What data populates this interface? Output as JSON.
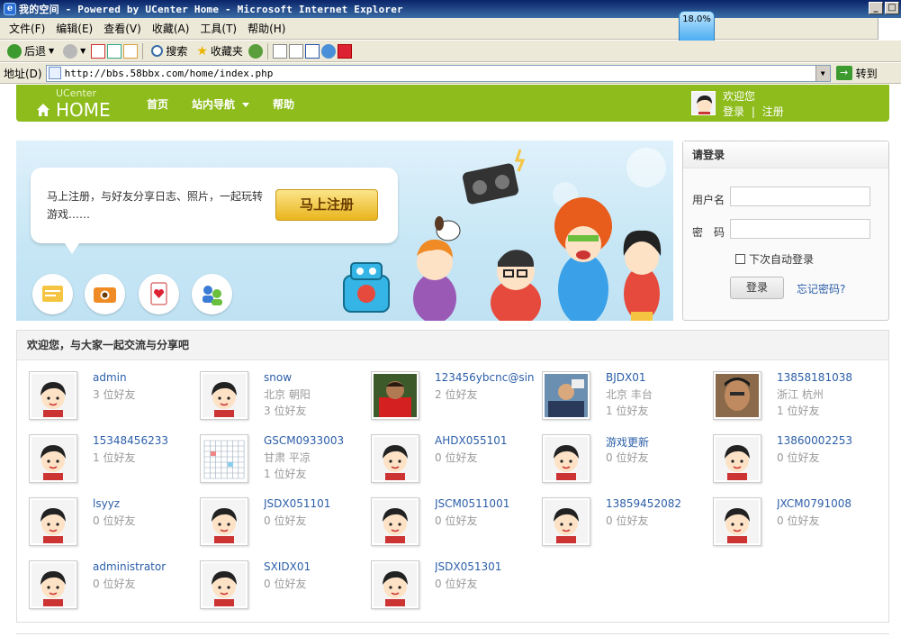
{
  "window": {
    "title": "我的空间 - Powered by UCenter Home - Microsoft Internet Explorer",
    "zoom_badge": "18.0%"
  },
  "menu": [
    "文件(F)",
    "编辑(E)",
    "查看(V)",
    "收藏(A)",
    "工具(T)",
    "帮助(H)"
  ],
  "toolbar": {
    "back": "后退",
    "search": "搜索",
    "favorites": "收藏夹"
  },
  "address": {
    "label": "地址(D)",
    "url": "http://bbs.58bbx.com/home/index.php",
    "go": "转到"
  },
  "site": {
    "logo_small": "UCenter",
    "logo_big": "HOME",
    "nav": [
      "首页",
      "站内导航",
      "帮助"
    ],
    "welcome": "欢迎您",
    "login_link": "登录",
    "register_link": "注册",
    "sep": "|"
  },
  "banner": {
    "text": "马上注册，与好友分享日志、照片，一起玩转游戏……",
    "signup_button": "马上注册"
  },
  "login": {
    "title": "请登录",
    "username_label": "用户名",
    "password_label": "密　码",
    "remember": "下次自动登录",
    "submit": "登录",
    "forgot": "忘记密码?"
  },
  "friends": {
    "heading": "欢迎您，与大家一起交流与分享吧",
    "items": [
      {
        "name": "admin",
        "line2": "3 位好友",
        "line3": "",
        "avatar": "default"
      },
      {
        "name": "snow",
        "line2": "北京 朝阳",
        "line3": "3 位好友",
        "avatar": "default"
      },
      {
        "name": "123456ybcnc@sin",
        "line2": "2 位好友",
        "line3": "",
        "avatar": "photo-red"
      },
      {
        "name": "BJDX01",
        "line2": "北京 丰台",
        "line3": "1 位好友",
        "avatar": "photo-blue"
      },
      {
        "name": "13858181038",
        "line2": "浙江 杭州",
        "line3": "1 位好友",
        "avatar": "photo-face"
      },
      {
        "name": "15348456233",
        "line2": "1 位好友",
        "line3": "",
        "avatar": "default"
      },
      {
        "name": "GSCM0933003",
        "line2": "甘肃 平凉",
        "line3": "1 位好友",
        "avatar": "calendar"
      },
      {
        "name": "AHDX055101",
        "line2": "0 位好友",
        "line3": "",
        "avatar": "default"
      },
      {
        "name": "游戏更新",
        "line2": "0 位好友",
        "line3": "",
        "avatar": "default"
      },
      {
        "name": "13860002253",
        "line2": "0 位好友",
        "line3": "",
        "avatar": "default"
      },
      {
        "name": "lsyyz",
        "line2": "0 位好友",
        "line3": "",
        "avatar": "default"
      },
      {
        "name": "JSDX051101",
        "line2": "0 位好友",
        "line3": "",
        "avatar": "default"
      },
      {
        "name": "JSCM0511001",
        "line2": "0 位好友",
        "line3": "",
        "avatar": "default"
      },
      {
        "name": "13859452082",
        "line2": "0 位好友",
        "line3": "",
        "avatar": "default"
      },
      {
        "name": "JXCM0791008",
        "line2": "0 位好友",
        "line3": "",
        "avatar": "default"
      },
      {
        "name": "administrator",
        "line2": "0 位好友",
        "line3": "",
        "avatar": "default"
      },
      {
        "name": "SXIDX01",
        "line2": "0 位好友",
        "line3": "",
        "avatar": "default"
      },
      {
        "name": "JSDX051301",
        "line2": "0 位好友",
        "line3": "",
        "avatar": "default"
      }
    ]
  },
  "colors": {
    "brand_green": "#8dbc1c",
    "link_blue": "#2b5ea8",
    "muted_gray": "#999999"
  }
}
